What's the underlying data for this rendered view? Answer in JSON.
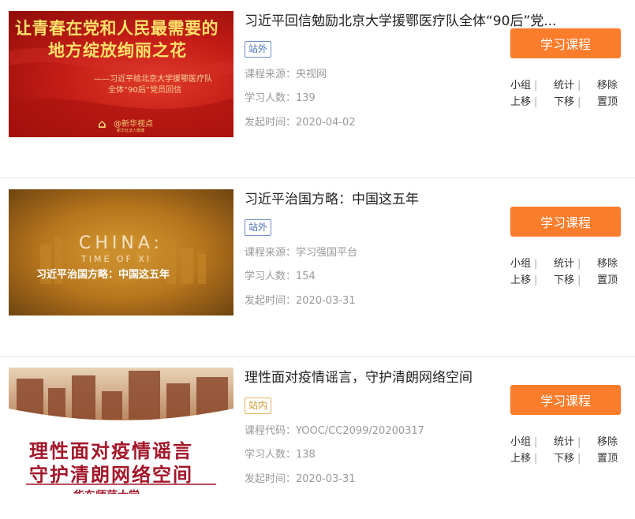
{
  "courses": [
    {
      "title": "习近平回信勉励北京大学援鄂医疗队全体“90后”党...",
      "badge": "站外",
      "meta1_label": "课程来源：",
      "meta1_value": "央视网",
      "learners_label": "学习人数：",
      "learners": "139",
      "date_label": "发起时间：",
      "date": "2020-04-02",
      "button": "学习课程",
      "ops_row1": [
        "小组",
        "统计",
        "移除"
      ],
      "ops_row2": [
        "上移",
        "下移",
        "置顶"
      ],
      "thumb": {
        "line1": "让青春在党和人民最需要的",
        "line2": "地方绽放绚丽之花",
        "sub1": "——习近平给北京大学援鄂医疗队",
        "sub2": "全体“90后”党员回信",
        "logo": "@新华视点",
        "logo_sub": "新华社法人微博"
      }
    },
    {
      "title": "习近平治国方略：中国这五年",
      "badge": "站外",
      "meta1_label": "课程来源：",
      "meta1_value": "学习强国平台",
      "learners_label": "学习人数：",
      "learners": "154",
      "date_label": "发起时间：",
      "date": "2020-03-31",
      "button": "学习课程",
      "ops_row1": [
        "小组",
        "统计",
        "移除"
      ],
      "ops_row2": [
        "上移",
        "下移",
        "置顶"
      ],
      "thumb": {
        "en1": "CHINA:",
        "en2": "TIME OF XI",
        "cn": "习近平治国方略：中国这五年"
      }
    },
    {
      "title": "理性面对疫情谣言，守护清朗网络空间",
      "badge": "站内",
      "meta1_label": "课程代码：",
      "meta1_value": "YOOC/CC2099/20200317",
      "learners_label": "学习人数：",
      "learners": "138",
      "date_label": "发起时间：",
      "date": "2020-03-31",
      "button": "学习课程",
      "ops_row1": [
        "小组",
        "统计",
        "移除"
      ],
      "ops_row2": [
        "上移",
        "下移",
        "置顶"
      ],
      "thumb": {
        "line1": "理性面对疫情谣言",
        "line2": "守护清朗网络空间",
        "school": "华东师范大学"
      }
    }
  ],
  "colors": {
    "accent": "#fb7c2b",
    "badge_outer": "#4a73b5",
    "badge_inner": "#d19a2e",
    "meta": "#9a9a9a"
  }
}
